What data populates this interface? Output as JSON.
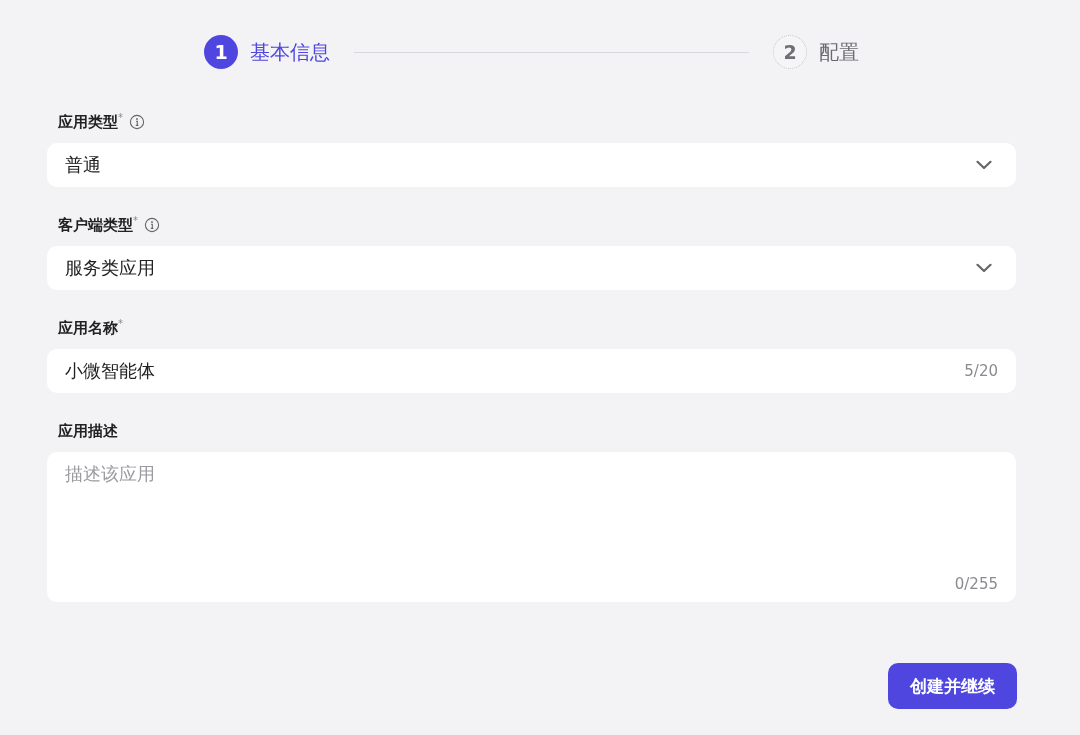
{
  "steps": [
    {
      "number": "1",
      "label": "基本信息",
      "selected": true
    },
    {
      "number": "2",
      "label": "配置",
      "selected": false
    }
  ],
  "form": {
    "fields": [
      {
        "kind": "select",
        "label": "应用类型$^{*}$",
        "info_icon": true,
        "value": "普通"
      },
      {
        "kind": "select",
        "label": "客户端类型$^{*}$",
        "info_icon": true,
        "value": "服务类应用"
      },
      {
        "kind": "input",
        "label": "应用名称$^{*}$",
        "info_icon": false,
        "value": "小微智能体",
        "counter": "5/20"
      },
      {
        "kind": "textarea",
        "label": "应用描述",
        "info_icon": false,
        "placeholder": "描述该应用",
        "counter": "0/255"
      }
    ]
  },
  "submit_button": {
    "label": "创建并继续"
  }
}
